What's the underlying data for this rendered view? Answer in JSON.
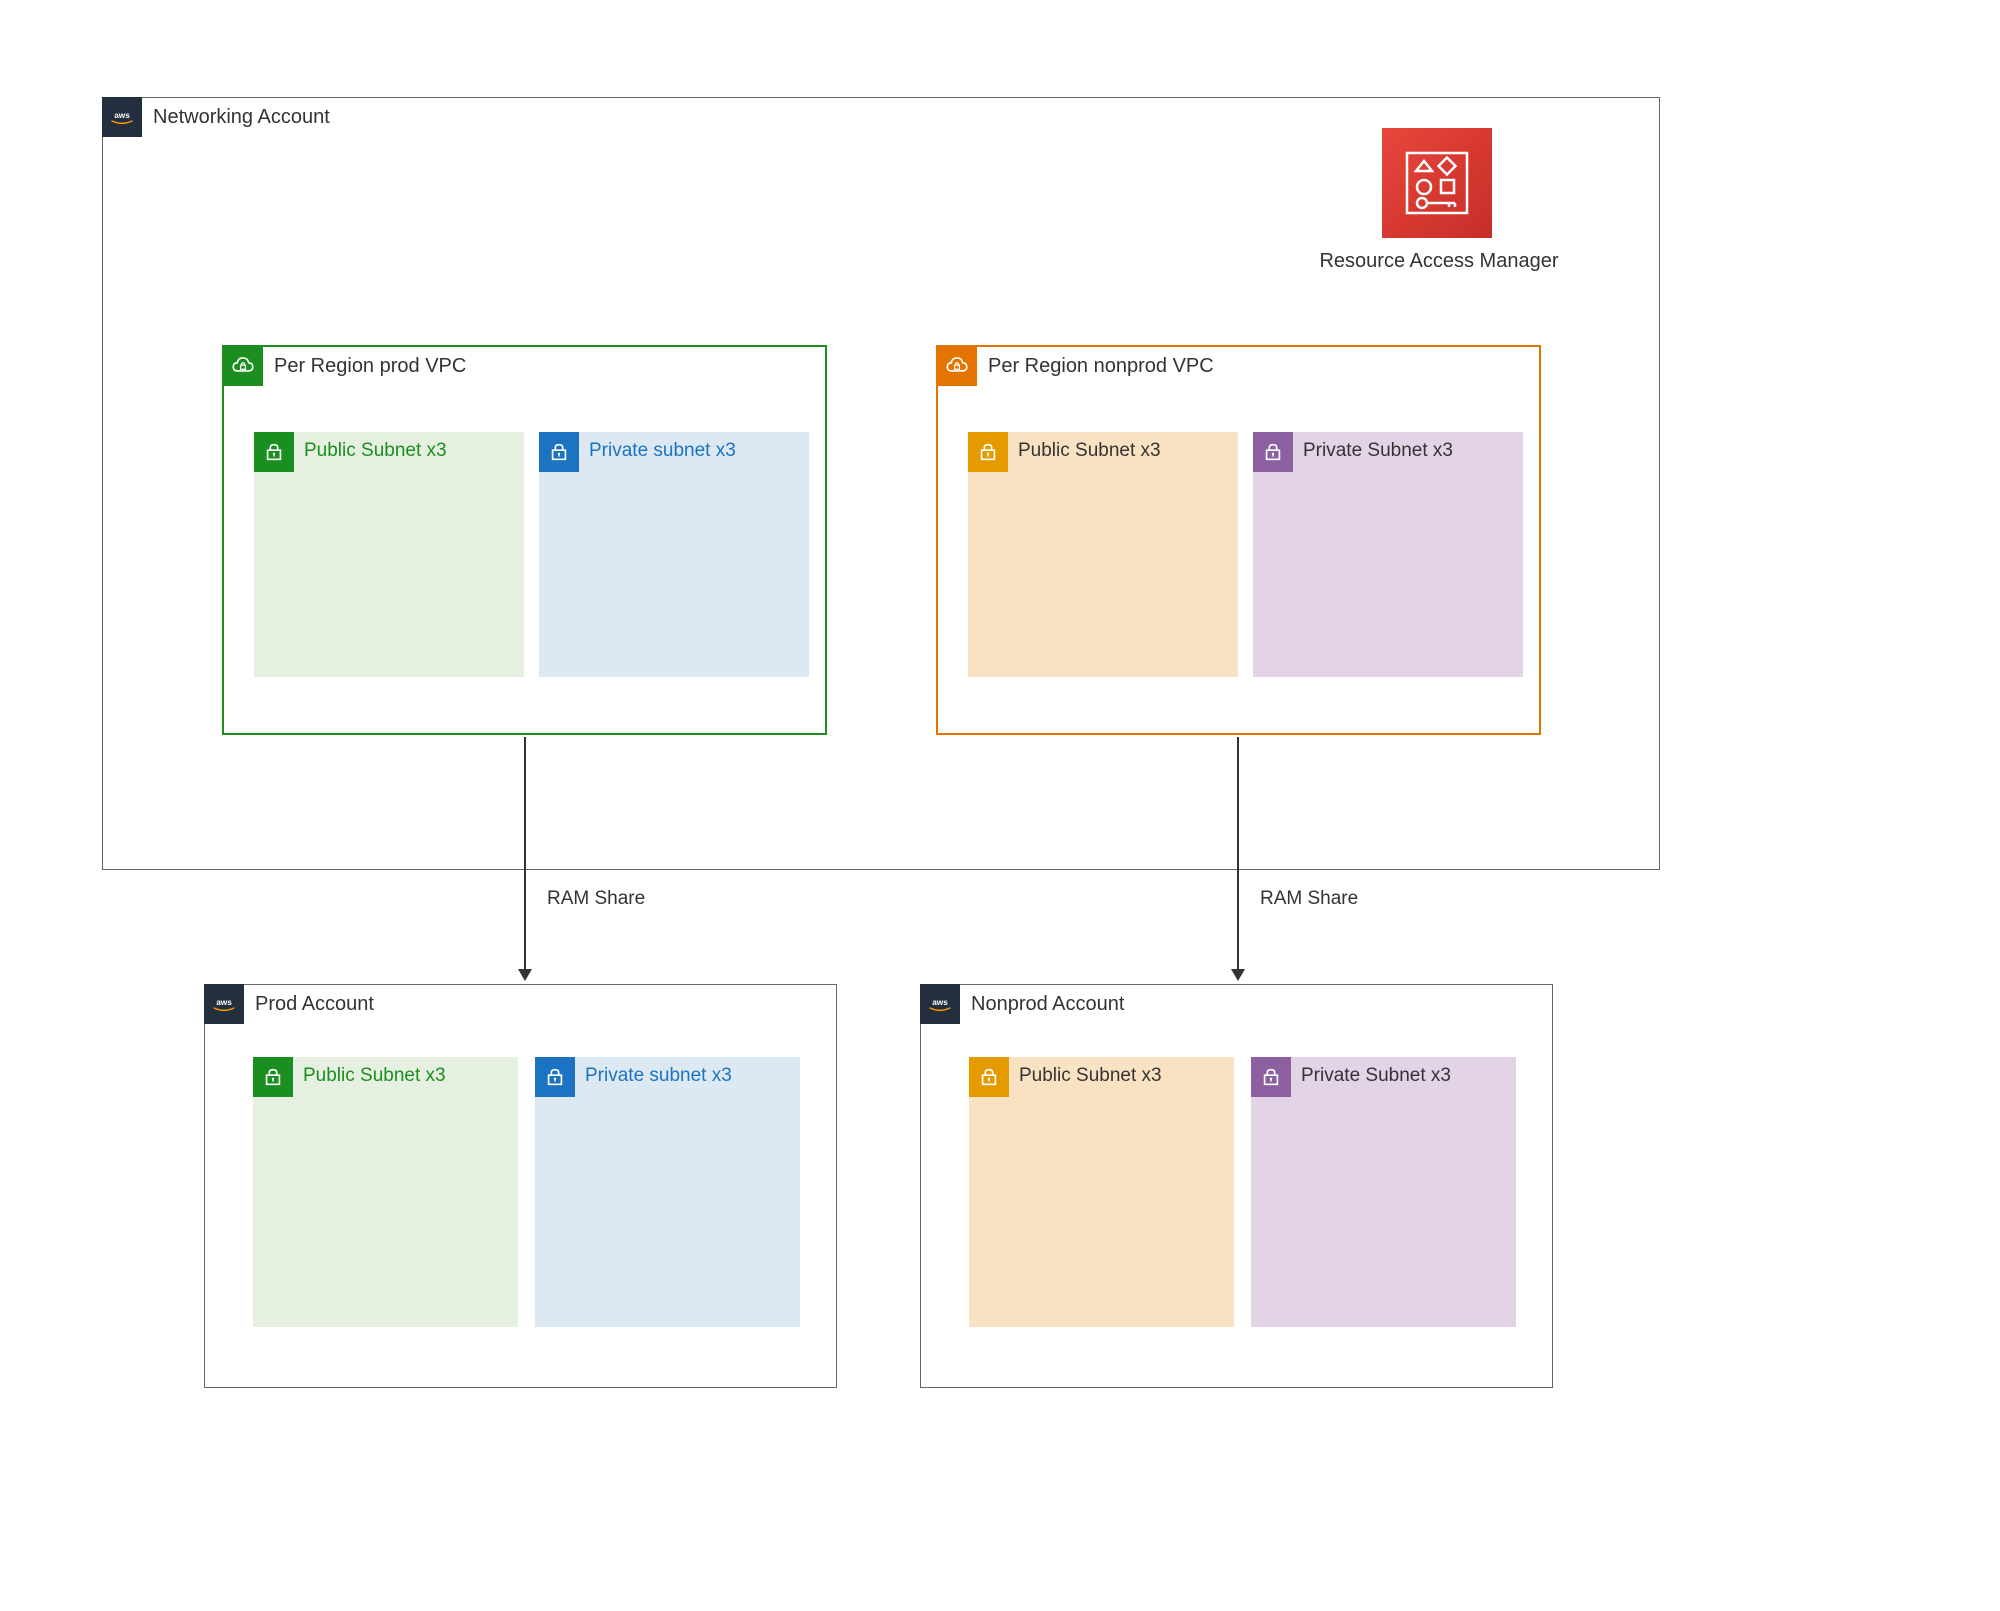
{
  "networking_account": {
    "label": "Networking Account",
    "prod_vpc": {
      "label": "Per Region prod VPC",
      "public_subnet": "Public Subnet x3",
      "private_subnet": "Private subnet x3"
    },
    "nonprod_vpc": {
      "label": "Per Region nonprod VPC",
      "public_subnet": "Public Subnet x3",
      "private_subnet": "Private Subnet x3"
    }
  },
  "ram": {
    "label": "Resource Access Manager",
    "share_label_left": "RAM Share",
    "share_label_right": "RAM Share"
  },
  "prod_account": {
    "label": "Prod Account",
    "public_subnet": "Public Subnet x3",
    "private_subnet": "Private subnet x3"
  },
  "nonprod_account": {
    "label": "Nonprod Account",
    "public_subnet": "Public Subnet x3",
    "private_subnet": "Private Subnet x3"
  },
  "colors": {
    "prod_vpc_border": "#1b8e20",
    "nonprod_vpc_border": "#e37400",
    "subnet_green_bg": "#e6f0e0",
    "subnet_green_badge": "#1b8e20",
    "subnet_green_text": "#1b8e20",
    "subnet_blue_bg": "#dce9f2",
    "subnet_blue_badge": "#1c73c2",
    "subnet_blue_text": "#1c73c2",
    "subnet_orange_bg": "#f9e2c2",
    "subnet_orange_badge": "#e59b00",
    "subnet_orange_text": "#333333",
    "subnet_purple_bg": "#e3d3e7",
    "subnet_purple_badge": "#8b5fa0",
    "subnet_purple_text": "#333333"
  }
}
